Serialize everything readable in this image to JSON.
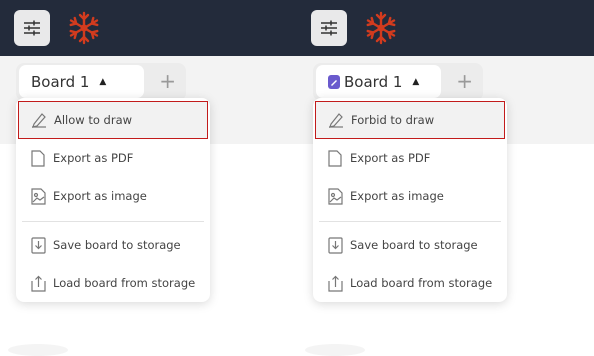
{
  "colors": {
    "topbar": "#232b3b",
    "highlight_border": "#c21b1b",
    "snowflake": "#d23b1e",
    "lock_badge": "#6a5acd"
  },
  "icons": {
    "settings": "sliders-icon",
    "logo": "snowflake-icon",
    "caret": "caret-up-icon",
    "add": "plus-icon"
  },
  "panels": [
    {
      "board_name": "Board 1",
      "add_label": "+",
      "menu": {
        "toggle_draw": "Allow to draw",
        "export_pdf": "Export as PDF",
        "export_image": "Export as image",
        "save_storage": "Save board to storage",
        "load_storage": "Load board from storage"
      }
    },
    {
      "board_name": "Board 1",
      "add_label": "+",
      "menu": {
        "toggle_draw": "Forbid to draw",
        "export_pdf": "Export as PDF",
        "export_image": "Export as image",
        "save_storage": "Save board to storage",
        "load_storage": "Load board from storage"
      }
    }
  ]
}
